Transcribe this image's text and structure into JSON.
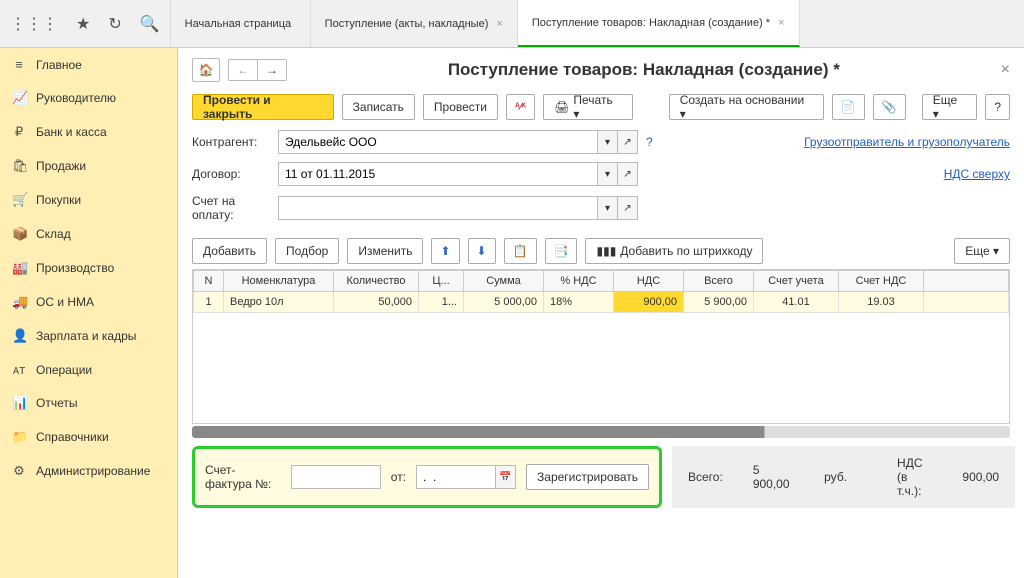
{
  "tabs": [
    {
      "label": "Начальная страница"
    },
    {
      "label": "Поступление (акты, накладные)"
    },
    {
      "label": "Поступление товаров: Накладная (создание) *"
    }
  ],
  "sidebar": {
    "items": [
      {
        "icon": "≡",
        "label": "Главное"
      },
      {
        "icon": "📈",
        "label": "Руководителю"
      },
      {
        "icon": "₽",
        "label": "Банк и касса"
      },
      {
        "icon": "🛍",
        "label": "Продажи"
      },
      {
        "icon": "🛒",
        "label": "Покупки"
      },
      {
        "icon": "📦",
        "label": "Склад"
      },
      {
        "icon": "🏭",
        "label": "Производство"
      },
      {
        "icon": "🚚",
        "label": "ОС и НМА"
      },
      {
        "icon": "👤",
        "label": "Зарплата и кадры"
      },
      {
        "icon": "ᴀᴛ",
        "label": "Операции"
      },
      {
        "icon": "📊",
        "label": "Отчеты"
      },
      {
        "icon": "📁",
        "label": "Справочники"
      },
      {
        "icon": "⚙",
        "label": "Администрирование"
      }
    ]
  },
  "page": {
    "title": "Поступление товаров: Накладная (создание) *"
  },
  "toolbar": {
    "post_close": "Провести и закрыть",
    "save": "Записать",
    "post": "Провести",
    "print": "Печать ▾",
    "create_based": "Создать на основании ▾",
    "more": "Еще ▾",
    "help": "?"
  },
  "form": {
    "counterparty_label": "Контрагент:",
    "counterparty_value": "Эдельвейс ООО",
    "q": "?",
    "shipper_link": "Грузоотправитель и грузополучатель",
    "contract_label": "Договор:",
    "contract_value": "11 от 01.11.2015",
    "vat_link": "НДС сверху",
    "account_label": "Счет на оплату:",
    "account_value": ""
  },
  "tbl_toolbar": {
    "add": "Добавить",
    "select": "Подбор",
    "edit": "Изменить",
    "barcode": "Добавить по штрихкоду",
    "more": "Еще ▾"
  },
  "table": {
    "headers": [
      "N",
      "Номенклатура",
      "Количество",
      "Ц...",
      "Сумма",
      "% НДС",
      "НДС",
      "Всего",
      "Счет учета",
      "Счет НДС",
      ""
    ],
    "rows": [
      {
        "n": "1",
        "nom": "Ведро 10л",
        "qty": "50,000",
        "price": "1...",
        "sum": "5 000,00",
        "vat_pct": "18%",
        "vat": "900,00",
        "total": "5 900,00",
        "acc1": "41.01",
        "acc2": "19.03",
        "ext": ""
      }
    ]
  },
  "invoice": {
    "label": "Счет-фактура №:",
    "num": "",
    "from": "от:",
    "date": ".  .",
    "register": "Зарегистрировать"
  },
  "totals": {
    "total_label": "Всего:",
    "total_value": "5 900,00",
    "currency": "руб.",
    "vat_label": "НДС (в т.ч.):",
    "vat_value": "900,00"
  }
}
